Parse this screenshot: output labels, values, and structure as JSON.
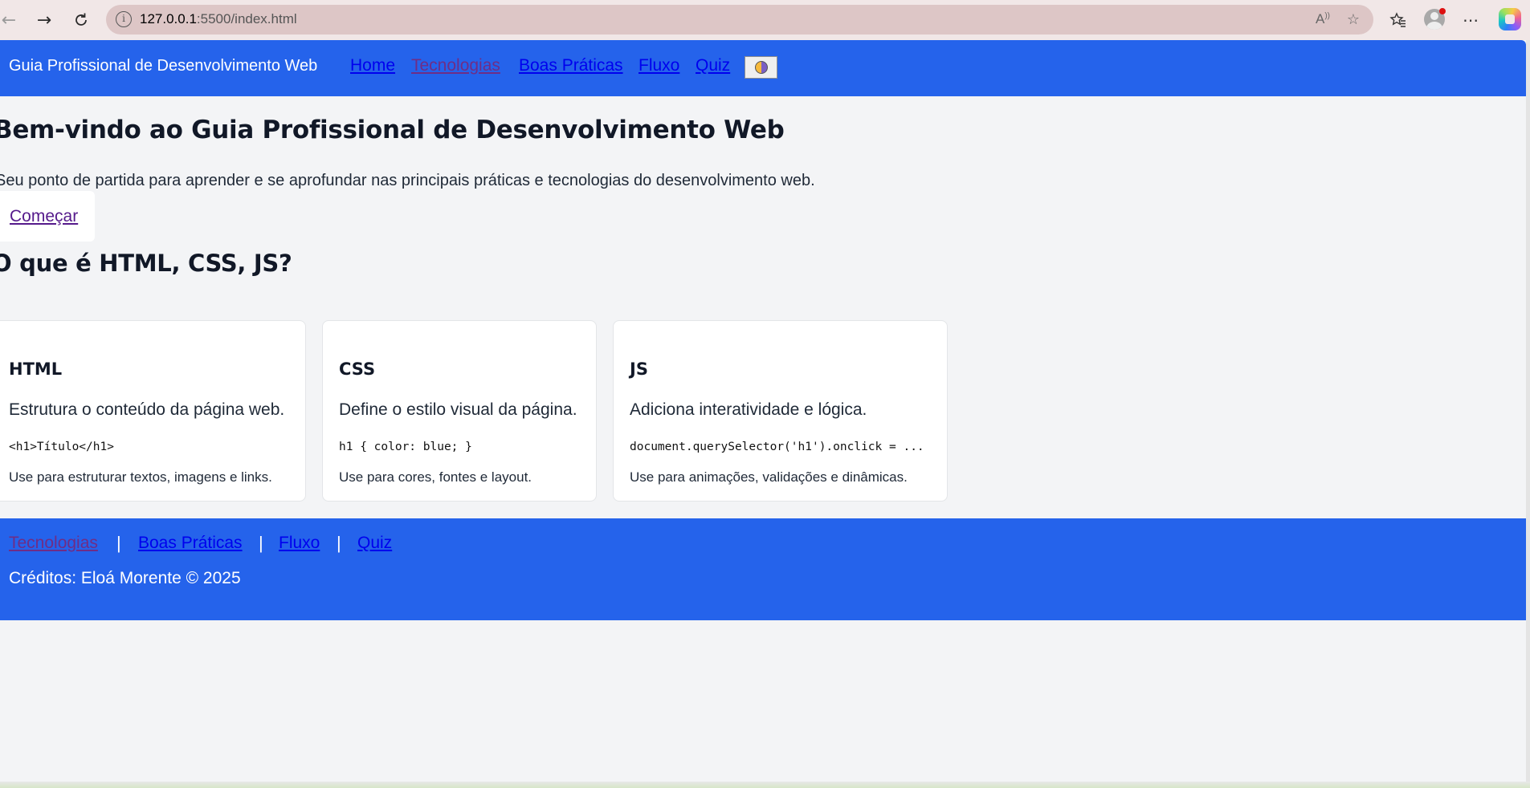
{
  "browser": {
    "url_host": "127.0.0.1",
    "url_path": ":5500/index.html",
    "icons": {
      "back": "arrow-left-icon",
      "forward": "arrow-right-icon",
      "refresh": "refresh-icon",
      "site_info": "info-icon",
      "read_aloud": "read-aloud-icon",
      "favorite": "star-icon",
      "favorites": "favorites-icon",
      "profile": "avatar",
      "menu": "more-icon",
      "copilot": "copilot-icon"
    }
  },
  "header": {
    "brand": "Guia Profissional de Desenvolvimento Web",
    "nav": [
      {
        "label": "Home"
      },
      {
        "label": "Tecnologias"
      },
      {
        "label": "Boas Práticas"
      },
      {
        "label": "Fluxo"
      },
      {
        "label": "Quiz"
      }
    ],
    "theme_toggle_icon": "theme-toggle-icon"
  },
  "hero": {
    "title": "Bem-vindo ao Guia Profissional de Desenvolvimento Web",
    "subtitle": "Seu ponto de partida para aprender e se aprofundar nas principais práticas e tecnologias do desenvolvimento web.",
    "cta": "Começar"
  },
  "section": {
    "title": "O que é HTML, CSS, JS?"
  },
  "cards": [
    {
      "title": "HTML",
      "description": "Estrutura o conteúdo da página web.",
      "code": "<h1>Título</h1>",
      "usage": "Use para estruturar textos, imagens e links."
    },
    {
      "title": "CSS",
      "description": "Define o estilo visual da página.",
      "code": "h1 { color: blue; }",
      "usage": "Use para cores, fontes e layout."
    },
    {
      "title": "JS",
      "description": "Adiciona interatividade e lógica.",
      "code": "document.querySelector('h1').onclick = ...",
      "usage": "Use para animações, validações e dinâmicas."
    }
  ],
  "footer": {
    "links": [
      {
        "label": "Tecnologias"
      },
      {
        "label": "Boas Práticas"
      },
      {
        "label": "Fluxo"
      },
      {
        "label": "Quiz"
      }
    ],
    "separator": "|",
    "credits": "Créditos: Eloá Morente © 2025"
  },
  "colors": {
    "header_bg": "#2563eb",
    "page_bg": "#f3f4f6",
    "link": "#0000ee",
    "visited_link": "#6f2d86"
  }
}
